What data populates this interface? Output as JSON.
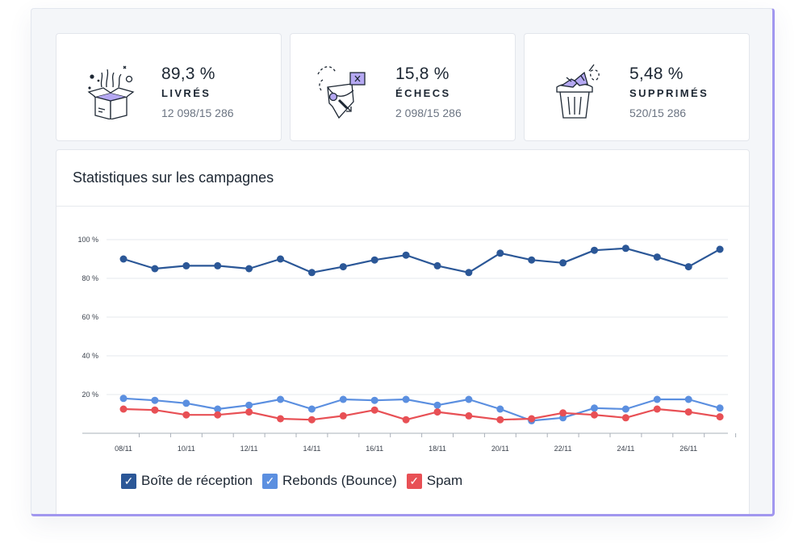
{
  "cards": [
    {
      "percent": "89,3 %",
      "label": "LIVRÉS",
      "count": "12 098/15 286",
      "icon": "open-box-icon"
    },
    {
      "percent": "15,8 %",
      "label": "ÉCHECS",
      "count": "2 098/15 286",
      "icon": "failed-envelope-icon"
    },
    {
      "percent": "5,48 %",
      "label": "SUPPRIMÉS",
      "count": "520/15 286",
      "icon": "trash-can-icon"
    }
  ],
  "stats": {
    "title": "Statistiques sur les campagnes"
  },
  "colors": {
    "inbox": "#2b5797",
    "bounce": "#5b8fe0",
    "spam": "#e85055",
    "accent": "#a197ef"
  },
  "chart_data": {
    "type": "line",
    "title": "",
    "ylim": [
      0,
      100
    ],
    "y_ticks": [
      "20 %",
      "40 %",
      "60 %",
      "80 %",
      "100 %"
    ],
    "y_tick_values": [
      20,
      40,
      60,
      80,
      100
    ],
    "x_tick_labels": [
      "08/11",
      "10/11",
      "12/11",
      "14/11",
      "16/11",
      "18/11",
      "20/11",
      "22/11",
      "24/11",
      "26/11"
    ],
    "grid": true,
    "series": [
      {
        "name": "Boîte de réception",
        "color": "#2b5797",
        "values": [
          90,
          85,
          86.5,
          86.5,
          85,
          90,
          83,
          86,
          89.5,
          92,
          86.5,
          83,
          93,
          89.5,
          88,
          94.5,
          95.5,
          91,
          86,
          95
        ]
      },
      {
        "name": "Rebonds (Bounce)",
        "color": "#5b8fe0",
        "values": [
          18,
          17,
          15.5,
          12.5,
          14.5,
          17.5,
          12.5,
          17.5,
          17,
          17.5,
          14.5,
          17.5,
          12.5,
          6.5,
          8,
          13,
          12.5,
          17.5,
          17.5,
          13
        ]
      },
      {
        "name": "Spam",
        "color": "#e85055",
        "values": [
          12.5,
          12,
          9.5,
          9.5,
          11,
          7.5,
          7,
          9,
          12,
          7,
          11,
          9,
          7,
          7.5,
          10.5,
          9.5,
          8,
          12.5,
          11,
          8.5
        ]
      }
    ]
  }
}
